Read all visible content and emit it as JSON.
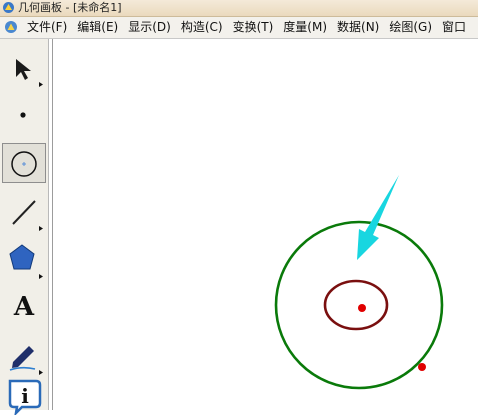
{
  "window": {
    "title": "几何画板 - [未命名1]"
  },
  "menu": {
    "items": [
      "文件(F)",
      "编辑(E)",
      "显示(D)",
      "构造(C)",
      "变换(T)",
      "度量(M)",
      "数据(N)",
      "绘图(G)",
      "窗口"
    ]
  },
  "toolbar": {
    "tools": [
      {
        "name": "select-arrow-tool",
        "active": false
      },
      {
        "name": "point-tool",
        "active": false
      },
      {
        "name": "compass-tool",
        "active": true
      },
      {
        "name": "straightedge-tool",
        "active": false
      },
      {
        "name": "polygon-tool",
        "active": false
      },
      {
        "name": "text-tool",
        "label": "A",
        "active": false
      },
      {
        "name": "marker-tool",
        "active": false
      },
      {
        "name": "information-tool",
        "label": "i",
        "active": false
      }
    ]
  },
  "canvas": {
    "objects": [
      "outer-circle",
      "inner-ellipse",
      "center-point",
      "point-on-circle",
      "arrow-annotation"
    ],
    "colors": {
      "outer_circle": "#0a7a0a",
      "inner_ellipse": "#7a0f0f",
      "points": "#e00000",
      "arrow": "#18d6e0"
    }
  }
}
